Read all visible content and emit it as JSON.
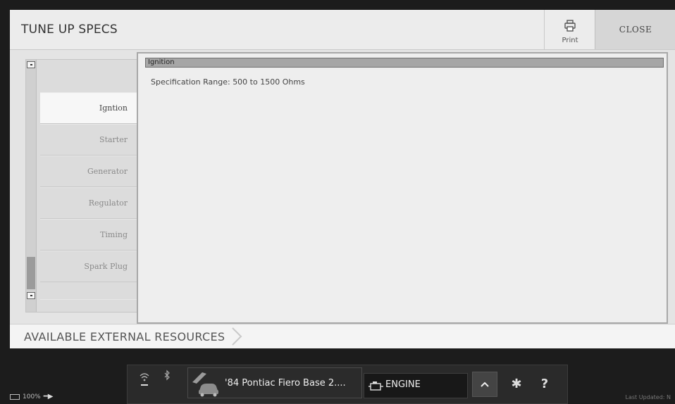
{
  "header": {
    "title": "TUNE UP SPECS",
    "print_label": "Print",
    "close_label": "CLOSE"
  },
  "sidebar": {
    "items": [
      {
        "label": "Igntion",
        "active": true
      },
      {
        "label": "Starter",
        "active": false
      },
      {
        "label": "Generator",
        "active": false
      },
      {
        "label": "Regulator",
        "active": false
      },
      {
        "label": "Timing",
        "active": false
      },
      {
        "label": "Spark Plug",
        "active": false
      }
    ]
  },
  "panel": {
    "section_title": "Ignition",
    "spec_text": "Specification Range: 500 to 1500 Ohms"
  },
  "resources": {
    "label": "AVAILABLE EXTERNAL RESOURCES"
  },
  "taskbar": {
    "battery": "100%",
    "vehicle": "'84 Pontiac Fiero Base 2....",
    "system": "ENGINE",
    "last_updated": "Last Updated: N"
  },
  "colors": {
    "background": "#1c1c1c",
    "content": "#e4e4e4",
    "header_bar": "#a6a6a6"
  },
  "icons": [
    "print-icon",
    "wifi-icon",
    "bluetooth-icon",
    "car-icon",
    "engine-icon",
    "chevron-up-icon",
    "gear-icon",
    "help-icon",
    "battery-icon",
    "plug-icon"
  ]
}
